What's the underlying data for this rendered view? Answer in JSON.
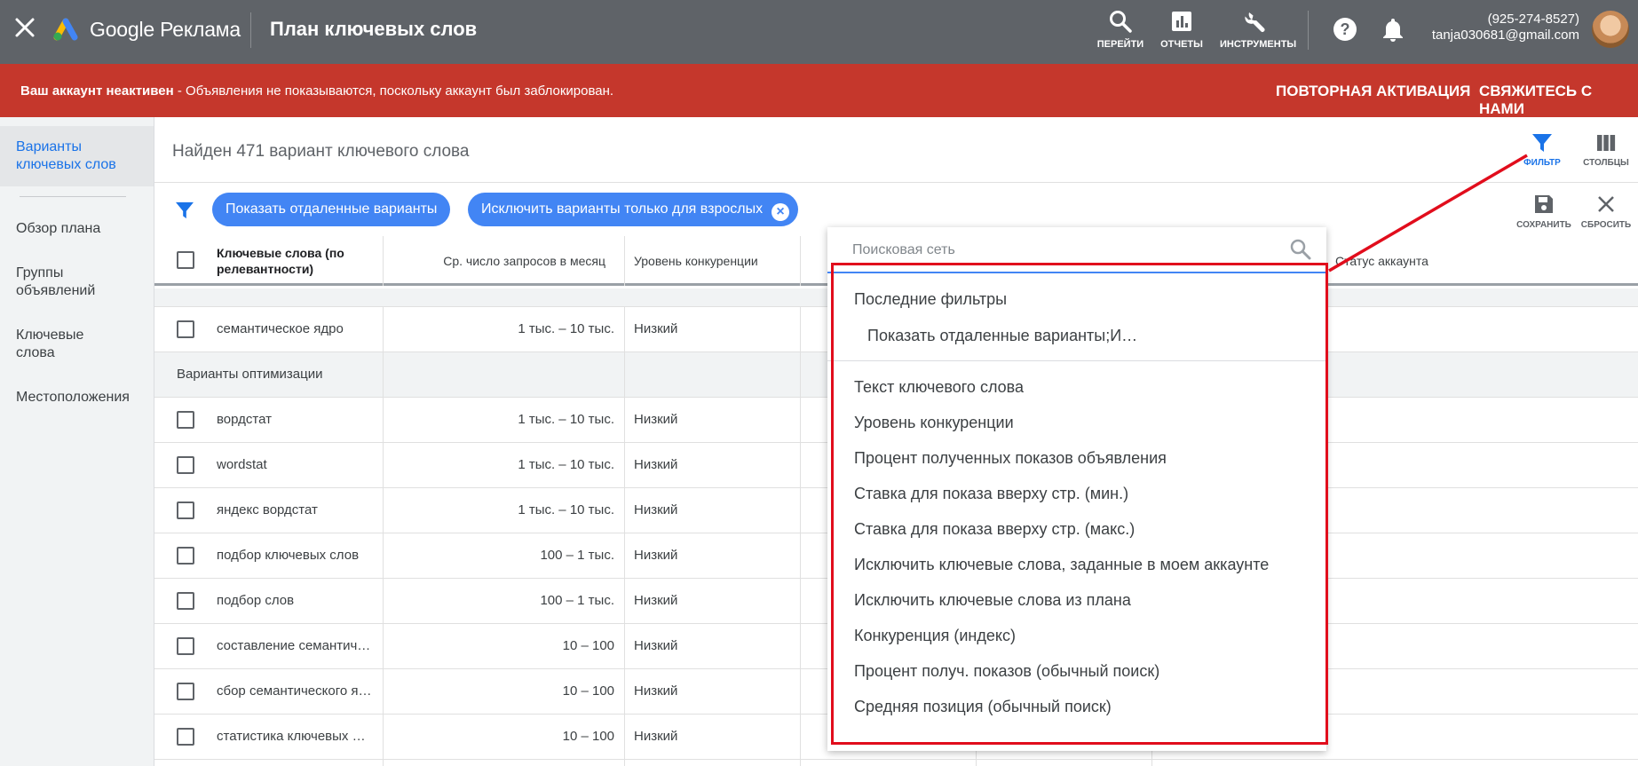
{
  "topbar": {
    "brand": "Google Реклама",
    "title": "План ключевых слов",
    "nav": [
      {
        "label": "ПЕРЕЙТИ",
        "icon": "search-icon"
      },
      {
        "label": "ОТЧЕТЫ",
        "icon": "reports-icon"
      },
      {
        "label": "ИНСТРУМЕНТЫ",
        "icon": "wrench-icon"
      }
    ],
    "phone": "(925-274-8527)",
    "email": "tanja030681@gmail.com"
  },
  "alert": {
    "bold": "Ваш аккаунт неактивен",
    "text": " - Объявления не показываются, поскольку аккаунт был заблокирован.",
    "reactivate": "ПОВТОРНАЯ АКТИВАЦИЯ",
    "contact": "СВЯЖИТЕСЬ С НАМИ"
  },
  "sidebar": {
    "items": [
      {
        "label": "Варианты ключевых слов"
      },
      {
        "label": "Обзор плана"
      },
      {
        "label": "Группы объявлений"
      },
      {
        "label": "Ключевые слова"
      },
      {
        "label": "Местоположения"
      }
    ]
  },
  "main": {
    "found": "Найден 471 вариант ключевого слова",
    "filter_label": "ФИЛЬТР",
    "columns_label": "СТОЛБЦЫ",
    "save_label": "СОХРАНИТЬ",
    "reset_label": "СБРОСИТЬ",
    "chips": [
      {
        "label": "Показать отдаленные варианты"
      },
      {
        "label": "Исключить варианты только для взрослых"
      }
    ]
  },
  "table": {
    "headers": {
      "keyword": "Ключевые слова (по релевантности)",
      "volume": "Ср. число запросов в месяц",
      "competition": "Уровень конкуренции",
      "status": "Статус аккаунта"
    },
    "top_row": {
      "keyword": "семантическое ядро",
      "volume": "1 тыс. – 10 тыс.",
      "competition": "Низкий"
    },
    "group_label": "Варианты оптимизации",
    "rows": [
      {
        "keyword": "вордстат",
        "volume": "1 тыс. – 10 тыс.",
        "competition": "Низкий"
      },
      {
        "keyword": "wordstat",
        "volume": "1 тыс. – 10 тыс.",
        "competition": "Низкий"
      },
      {
        "keyword": "яндекс вордстат",
        "volume": "1 тыс. – 10 тыс.",
        "competition": "Низкий"
      },
      {
        "keyword": "подбор ключевых слов",
        "volume": "100 – 1 тыс.",
        "competition": "Низкий"
      },
      {
        "keyword": "подбор слов",
        "volume": "100 – 1 тыс.",
        "competition": "Низкий"
      },
      {
        "keyword": "составление семантич…",
        "volume": "10 – 100",
        "competition": "Низкий"
      },
      {
        "keyword": "сбор семантического я…",
        "volume": "10 – 100",
        "competition": "Низкий"
      },
      {
        "keyword": "статистика ключевых …",
        "volume": "10 – 100",
        "competition": "Низкий"
      }
    ]
  },
  "dropdown": {
    "search_placeholder": "Поисковая сеть",
    "recent_title": "Последние фильтры",
    "recent_item": "Показать отдаленные варианты;И…",
    "items": [
      "Текст ключевого слова",
      "Уровень конкуренции",
      "Процент полученных показов объявления",
      "Ставка для показа вверху стр. (мин.)",
      "Ставка для показа вверху стр. (макс.)",
      "Исключить ключевые слова, заданные в моем аккаунте",
      "Исключить ключевые слова из плана",
      "Конкуренция (индекс)",
      "Процент получ. показов (обычный поиск)",
      "Средняя позиция (обычный поиск)"
    ]
  },
  "colors": {
    "topbar": "#5f6368",
    "alert": "#c5372c",
    "accent": "#4285f4",
    "highlight": "#e10d1c"
  }
}
